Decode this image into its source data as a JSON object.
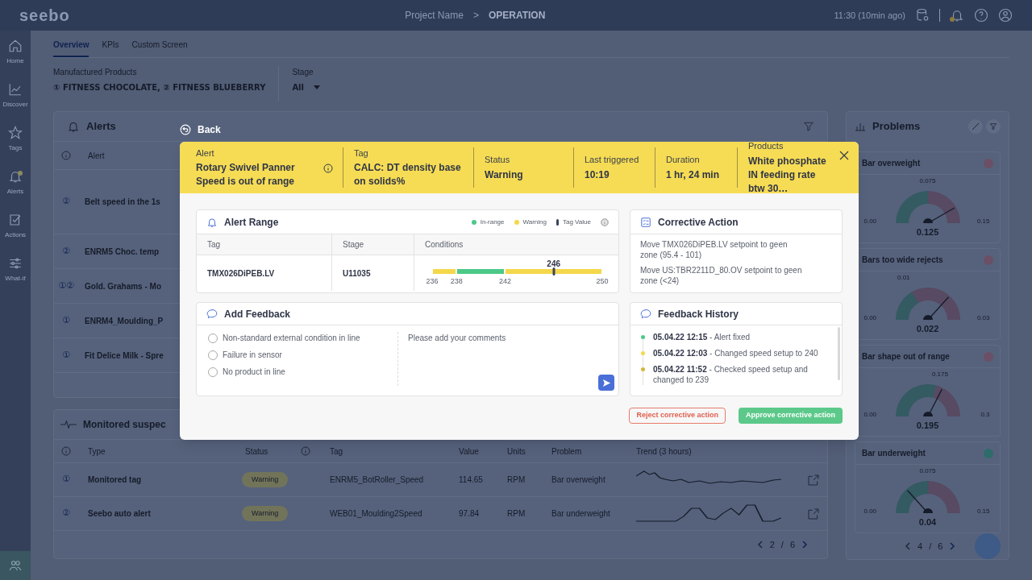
{
  "topbar": {
    "logo": "seebo",
    "project": "Project Name",
    "separator": ">",
    "screen": "OPERATION",
    "time": "11:30 (10min ago)"
  },
  "sidebar": [
    {
      "label": "Home",
      "dot": false
    },
    {
      "label": "Discover",
      "dot": false
    },
    {
      "label": "Tags",
      "dot": false
    },
    {
      "label": "Alerts",
      "dot": true
    },
    {
      "label": "Actions",
      "dot": false
    },
    {
      "label": "What-if",
      "dot": false
    }
  ],
  "tabs": [
    {
      "label": "Overview",
      "selected": true
    },
    {
      "label": "KPIs",
      "selected": false
    },
    {
      "label": "Custom Screen",
      "selected": false
    }
  ],
  "filters": [
    {
      "label": "Manufactured Products",
      "value": "① FITNESS CHOCOLATE, ② FITNESS BLUEBERRY",
      "dropdown": false
    },
    {
      "label": "Stage",
      "value": "All",
      "dropdown": true
    }
  ],
  "alerts": {
    "title": "Alerts",
    "column": "Alert",
    "rows": [
      {
        "stages": "②",
        "alert": "Belt speed in the 1s"
      },
      {
        "stages": "②",
        "alert": "ENRM5 Choc. temp"
      },
      {
        "stages": "①②",
        "alert": "Gold. Grahams - Mo"
      },
      {
        "stages": "①",
        "alert": "ENRM4_Moulding_P"
      },
      {
        "stages": "①",
        "alert": "Fit Delice Milk - Spre"
      }
    ]
  },
  "monitored": {
    "title": "Monitored suspec",
    "columns": [
      "Type",
      "Status",
      "Tag",
      "Value",
      "Units",
      "Problem",
      "Trend (3 hours)"
    ],
    "rows": [
      {
        "stages": "①",
        "type": "Monitored tag",
        "status": "Warning",
        "tag": "ENRM5_BotRoller_Speed",
        "value": "114.65",
        "units": "RPM",
        "problem": "Bar overweight"
      },
      {
        "stages": "②",
        "type": "Seebo auto alert",
        "status": "Warning",
        "tag": "WEB01_Moulding2Speed",
        "value": "97.84",
        "units": "RPM",
        "problem": "Bar underweight"
      }
    ],
    "pagination": {
      "page": "2",
      "separator": "/",
      "total": "6"
    }
  },
  "problems": {
    "title": "Problems",
    "cards": [
      {
        "name": "Bar overweight",
        "color": "#6b4f66",
        "min": "0.00",
        "mid": "0.075",
        "max": "0.15",
        "value": "0.125"
      },
      {
        "name": "Bars too wide rejects",
        "color": "#6b4f66",
        "min": "0.00",
        "mid": "0.01",
        "max": "0.03",
        "value": "0.022"
      },
      {
        "name": "Bar shape out of range",
        "color": "#6b4f66",
        "min": "0.00",
        "mid": "0.175",
        "max": "0.3",
        "value": "0.195"
      },
      {
        "name": "Bar underweight",
        "color": "#2e6b6b",
        "min": "0.00",
        "mid": "0.075",
        "max": "0.15",
        "value": "0.04"
      }
    ],
    "pagination": {
      "page": "4",
      "separator": "/",
      "total": "6"
    }
  },
  "modal": {
    "back": "Back",
    "header": [
      {
        "label": "Alert",
        "value": "Rotary Swivel Panner Speed is out of range",
        "info": true
      },
      {
        "label": "Tag",
        "value": "CALC: DT density base on solids%",
        "info": false
      },
      {
        "label": "Status",
        "value": "Warning",
        "info": false
      },
      {
        "label": "Last triggered",
        "value": "10:19",
        "info": false
      },
      {
        "label": "Duration",
        "value": "1 hr, 24 min",
        "info": false
      },
      {
        "label": "Products",
        "value": "White phosphate IN feeding rate btw 30…",
        "info": false
      }
    ],
    "alert_range": {
      "title": "Alert Range",
      "legend": [
        {
          "kind": "dot",
          "label": "In-range",
          "color": "#4cc988"
        },
        {
          "kind": "dot",
          "label": "Warning",
          "color": "#f4d84b"
        },
        {
          "kind": "bar",
          "label": "Tag Value",
          "color": "#3a4660"
        }
      ],
      "columns": [
        "Tag",
        "Stage",
        "Conditions"
      ],
      "row": {
        "tag": "TMX026DiPEB.LV",
        "stage": "U11035",
        "segments": [
          {
            "kind": "warning"
          },
          {
            "kind": "in_range"
          },
          {
            "kind": "warning"
          }
        ],
        "ticks": [
          "236",
          "238",
          "242",
          "250"
        ],
        "marker": {
          "label": "246"
        }
      }
    },
    "corrective_action": {
      "title": "Corrective Action",
      "items": [
        "Move TMX026DiPEB.LV setpoint to geen zone (95.4 - 101)",
        "Move US:TBR2211D_80.OV setpoint to geen zone (<24)"
      ]
    },
    "feedback": {
      "title": "Add Feedback",
      "options": [
        {
          "label": "Non-standard external condition in line",
          "selected": false
        },
        {
          "label": "Failure in sensor",
          "selected": false
        },
        {
          "label": "No product in line",
          "selected": false
        }
      ],
      "placeholder": "Please add your comments"
    },
    "history": {
      "title": "Feedback History",
      "items": [
        {
          "date": "05.04.22 12:15",
          "separator": "-",
          "text": "Alert fixed",
          "color": "#4cc988"
        },
        {
          "date": "05.04.22 12:03",
          "separator": "-",
          "text": "Changed speed setup to 240",
          "color": "#f4d84b"
        },
        {
          "date": "05.04.22 11:52",
          "separator": "-",
          "text": "Checked speed setup and changed to 239",
          "color": "#d9b53a"
        }
      ]
    },
    "actions": {
      "reject": "Reject corrective action",
      "approve": "Approve corrective action"
    }
  }
}
